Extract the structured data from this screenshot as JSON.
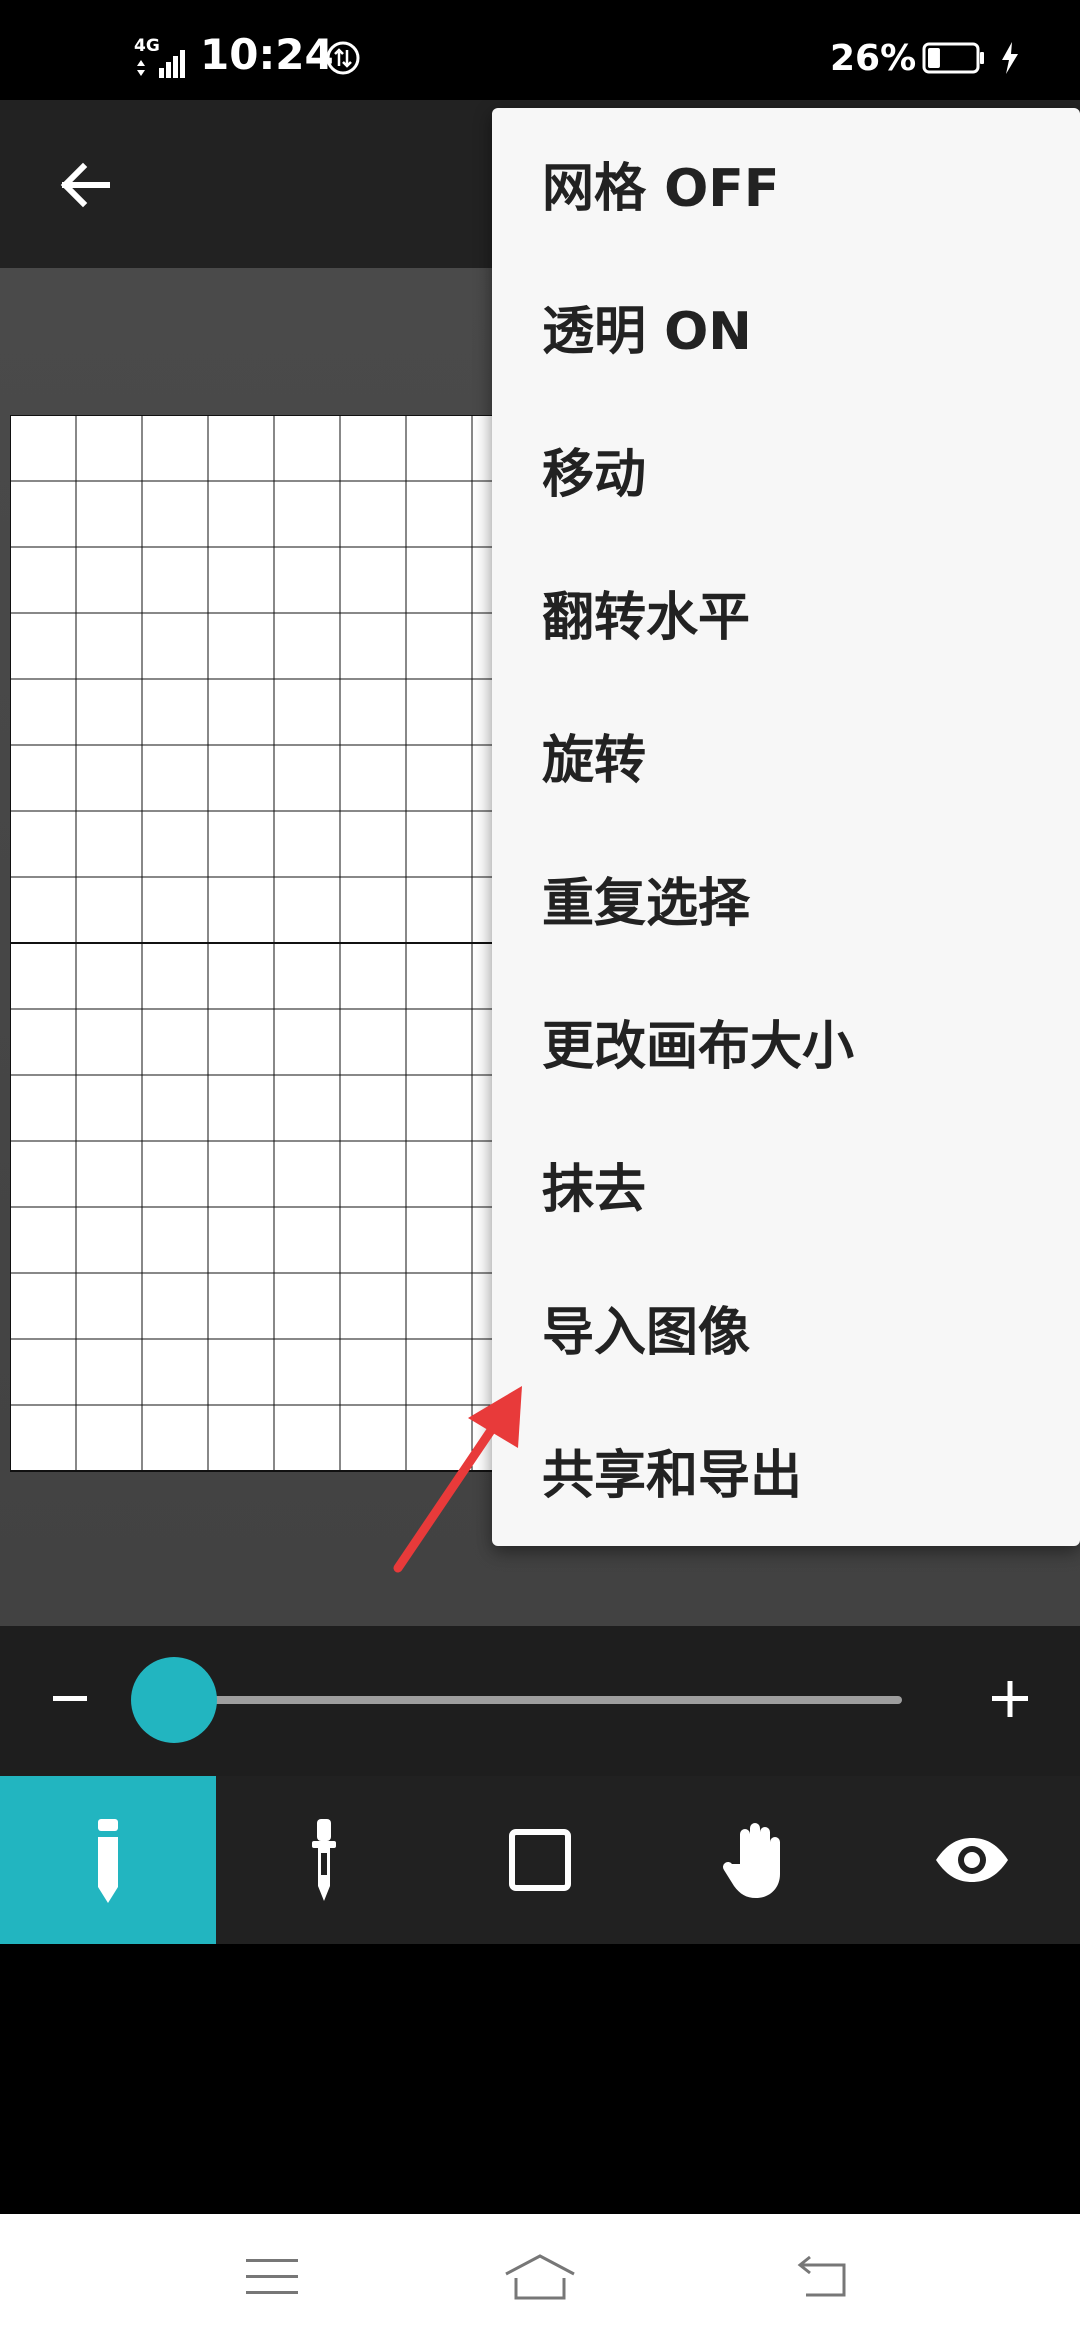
{
  "status_bar": {
    "network": "4G",
    "time": "10:24",
    "battery_percent": "26%",
    "battery_level": 0.26
  },
  "toolbar": {
    "back_icon": "arrow-left-icon"
  },
  "canvas": {
    "grid_columns": 22,
    "grid_rows": 16
  },
  "menu": {
    "items": [
      {
        "label": "网格 OFF"
      },
      {
        "label": "透明 ON"
      },
      {
        "label": "移动"
      },
      {
        "label": "翻转水平"
      },
      {
        "label": "旋转"
      },
      {
        "label": "重复选择"
      },
      {
        "label": "更改画布大小"
      },
      {
        "label": "抹去"
      },
      {
        "label": "导入图像"
      },
      {
        "label": "共享和导出"
      }
    ]
  },
  "brush_slider": {
    "minus_label": "−",
    "plus_label": "+",
    "value": 0
  },
  "tools": [
    {
      "icon": "pencil-icon",
      "active": true
    },
    {
      "icon": "eyedropper-icon",
      "active": false
    },
    {
      "icon": "square-select-icon",
      "active": false
    },
    {
      "icon": "hand-icon",
      "active": false
    },
    {
      "icon": "eye-icon",
      "active": false
    }
  ],
  "colors": {
    "accent": "#22b5c0",
    "arrow": "#e83a3a",
    "menu_bg": "#f7f7f7"
  }
}
